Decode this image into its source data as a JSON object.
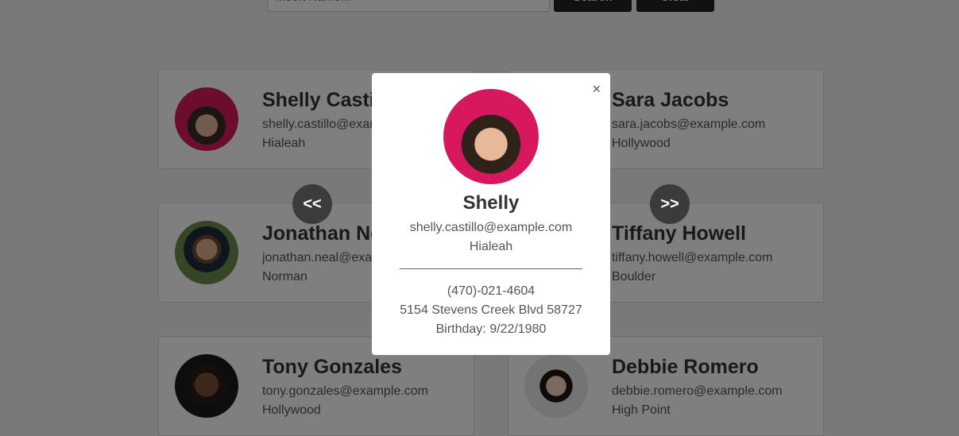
{
  "search": {
    "placeholder": "Insert Name...",
    "search_label": "Search",
    "clear_label": "Clear"
  },
  "employees": [
    {
      "name": "Shelly Castillo",
      "email": "shelly.castillo@example.com",
      "city": "Hialeah"
    },
    {
      "name": "Sara Jacobs",
      "email": "sara.jacobs@example.com",
      "city": "Hollywood"
    },
    {
      "name": "Jonathan Neal",
      "email": "jonathan.neal@example.com",
      "city": "Norman"
    },
    {
      "name": "Tiffany Howell",
      "email": "tiffany.howell@example.com",
      "city": "Boulder"
    },
    {
      "name": "Tony Gonzales",
      "email": "tony.gonzales@example.com",
      "city": "Hollywood"
    },
    {
      "name": "Debbie Romero",
      "email": "debbie.romero@example.com",
      "city": "High Point"
    }
  ],
  "nav": {
    "prev_label": "<<",
    "next_label": ">>"
  },
  "modal": {
    "close_label": "×",
    "name": "Shelly",
    "email": "shelly.castillo@example.com",
    "city": "Hialeah",
    "phone": "(470)-021-4604",
    "address": "5154 Stevens Creek Blvd 58727",
    "birthday": "Birthday: 9/22/1980"
  }
}
